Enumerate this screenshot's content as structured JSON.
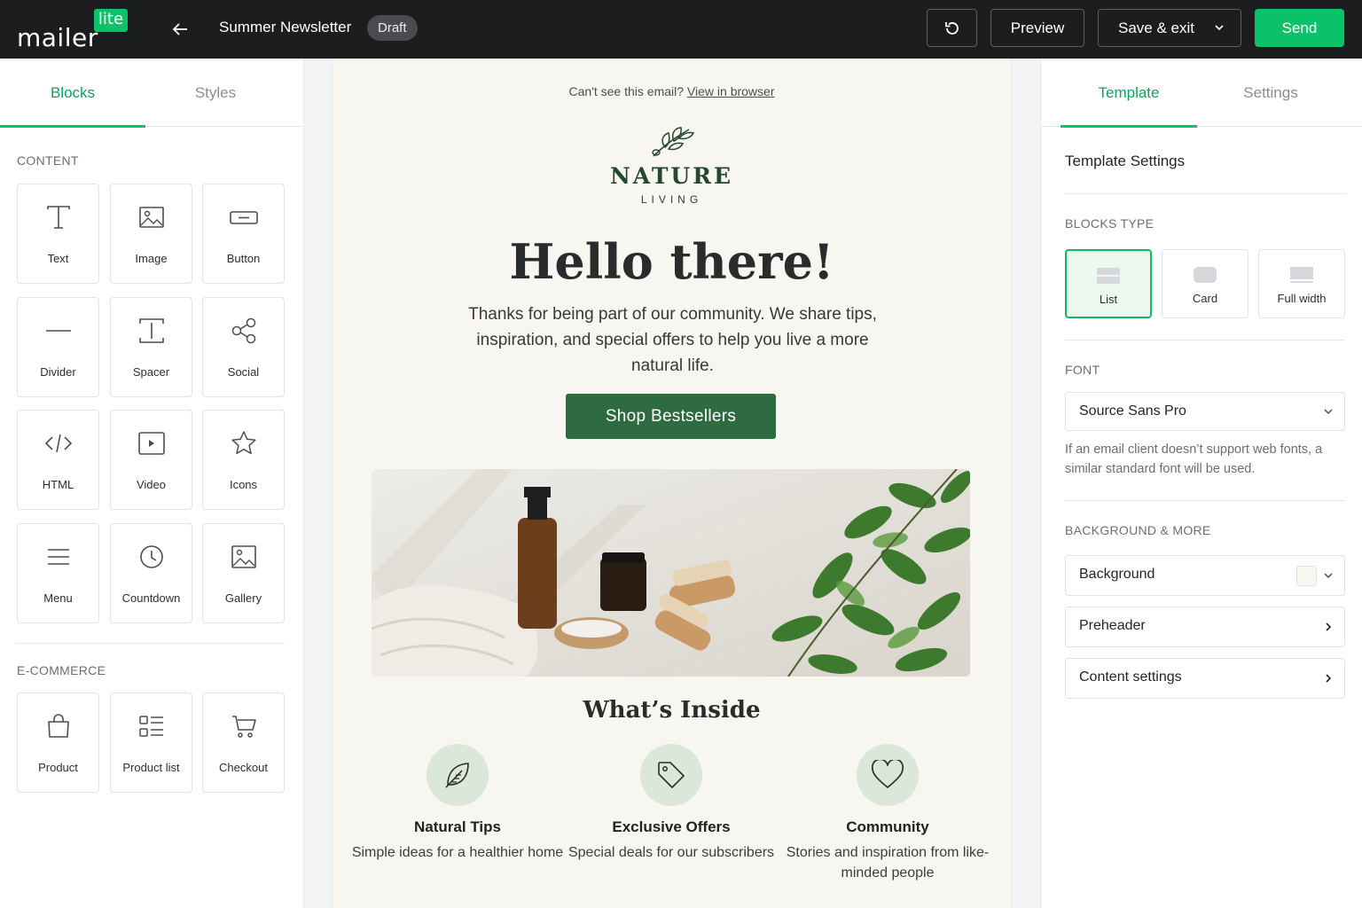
{
  "topbar": {
    "logo_word": "mailer",
    "logo_badge": "lite",
    "doc_title": "Summer Newsletter",
    "status_badge": "Draft",
    "preview_label": "Preview",
    "save_label": "Save & exit",
    "send_label": "Send",
    "accent": "#09c269"
  },
  "left": {
    "tabs": [
      "Blocks",
      "Styles"
    ],
    "content_label": "CONTENT",
    "content_blocks": [
      "Text",
      "Image",
      "Button",
      "Divider",
      "Spacer",
      "Social",
      "HTML",
      "Video",
      "Icons",
      "Menu",
      "Countdown",
      "Gallery"
    ],
    "ecommerce_label": "E-COMMERCE",
    "ecommerce_blocks": [
      "Product",
      "Product list",
      "Checkout"
    ]
  },
  "email": {
    "cant_see": "Can't see this email?",
    "view_link": "View in browser",
    "brand_name": "NATURE",
    "brand_sub": "LIVING",
    "hero_title": "Hello there!",
    "hero_text": "Thanks for being part of our community. We share tips, inspiration, and special offers to help you live a more natural life.",
    "cta_label": "Shop Bestsellers",
    "inside_title": "What’s Inside",
    "features": [
      {
        "title": "Natural Tips",
        "desc": "Simple ideas for a healthier home",
        "icon": "leaf-icon"
      },
      {
        "title": "Exclusive Offers",
        "desc": "Special deals for our subscribers",
        "icon": "tag-icon"
      },
      {
        "title": "Community",
        "desc": "Stories and inspiration from like-minded people",
        "icon": "heart-icon"
      }
    ],
    "brand_color": "#2f6b41"
  },
  "right": {
    "tabs": [
      "Template",
      "Settings"
    ],
    "title": "Template Settings",
    "blocks_type_label": "BLOCKS TYPE",
    "block_types": [
      "List",
      "Card",
      "Full width"
    ],
    "selected_block_type": "List",
    "font_label": "FONT",
    "font_value": "Source Sans Pro",
    "font_note": "If an email client doesn’t support web fonts, a similar standard font will be used.",
    "background_label": "BACKGROUND & MORE",
    "rows": [
      "Background",
      "Preheader",
      "Content settings"
    ]
  }
}
